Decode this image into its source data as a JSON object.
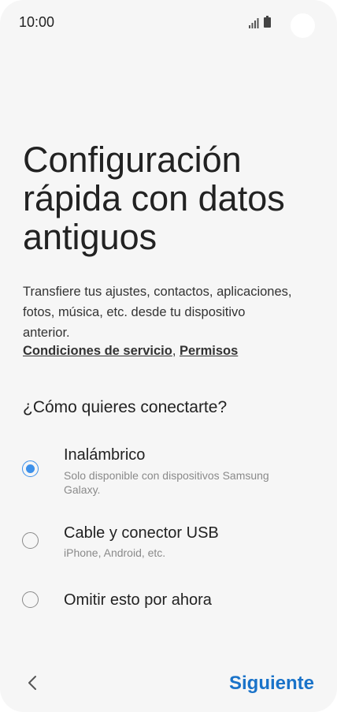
{
  "status_bar": {
    "time": "10:00",
    "icons": [
      "signal-icon",
      "battery-icon"
    ]
  },
  "title": {
    "lines": [
      "Configuración",
      "rápida con datos",
      "antiguos"
    ]
  },
  "description": {
    "lines": [
      "Transfiere tus ajustes, contactos, aplicaciones,",
      "fotos, música, etc. desde tu dispositivo",
      "anterior."
    ]
  },
  "links": {
    "terms": "Condiciones de servicio",
    "separator": ", ",
    "permissions": "Permisos"
  },
  "question": "¿Cómo quieres conectarte?",
  "options": [
    {
      "title": "Inalámbrico",
      "subtitle_lines": [
        "Solo disponible con dispositivos Samsung",
        "Galaxy."
      ],
      "selected": true
    },
    {
      "title": "Cable y conector USB",
      "subtitle_lines": [
        "iPhone, Android, etc."
      ],
      "selected": false
    },
    {
      "title": "Omitir esto por ahora",
      "subtitle_lines": [],
      "selected": false
    }
  ],
  "footer": {
    "back_icon": "chevron-left-icon",
    "next_label": "Siguiente"
  },
  "colors": {
    "accent": "#3e91ea",
    "next_button": "#1a73c9",
    "background": "#f6f6f6"
  }
}
